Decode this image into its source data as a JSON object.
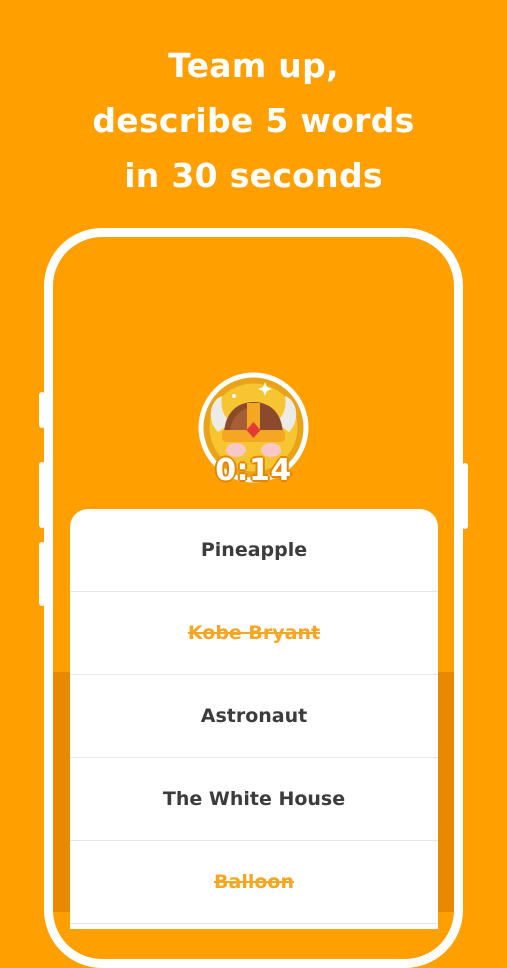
{
  "headline": {
    "line1": "Team up,",
    "line2": "describe 5 words",
    "line3": "in 30 seconds"
  },
  "game": {
    "avatar_icon": "viking-helmet-icon",
    "timer": "0:14",
    "words": [
      {
        "text": "Pineapple",
        "crossed": false
      },
      {
        "text": "Kobe Bryant",
        "crossed": true
      },
      {
        "text": "Astronaut",
        "crossed": false
      },
      {
        "text": "The White House",
        "crossed": false
      },
      {
        "text": "Balloon",
        "crossed": true
      }
    ]
  },
  "colors": {
    "background": "#FFA000",
    "crossed_word": "#F5A623",
    "word_text": "#3C3C3C"
  }
}
